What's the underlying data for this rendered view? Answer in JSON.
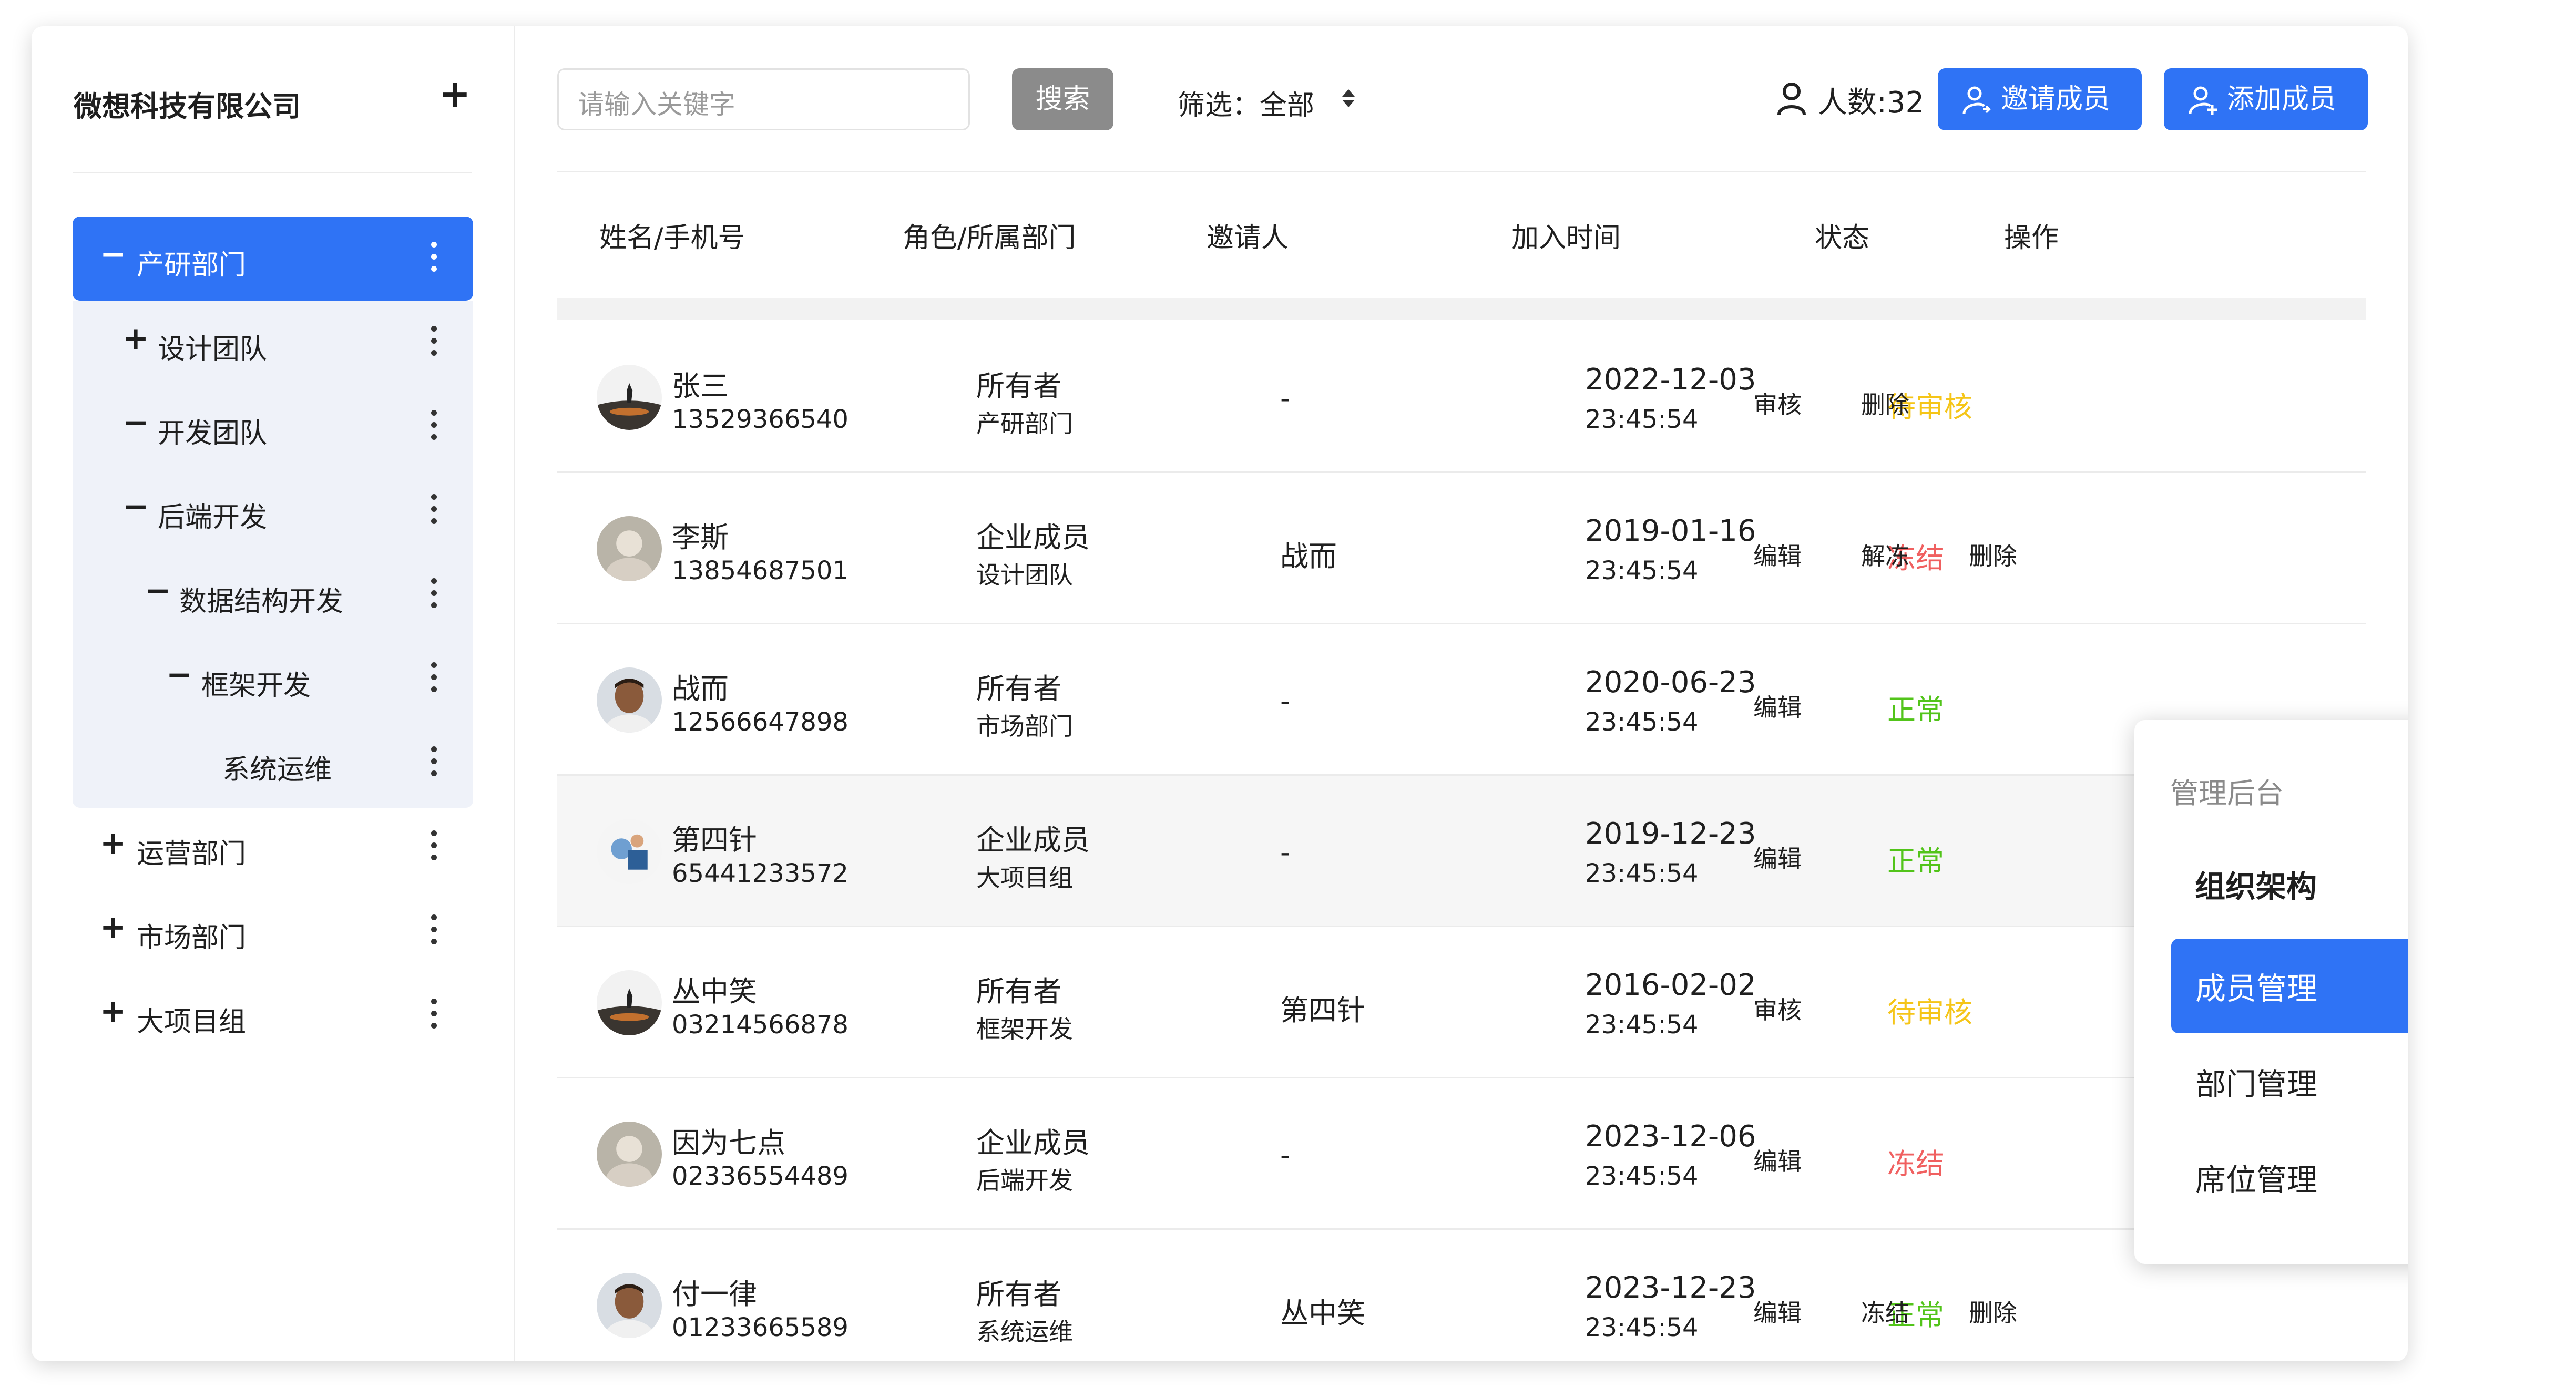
{
  "sidebar": {
    "company": "微想科技有限公司",
    "add_symbol": "+",
    "tree": [
      {
        "sign": "−",
        "label": "产研部门",
        "level": 0
      },
      {
        "sign": "+",
        "label": "设计团队",
        "level": 1
      },
      {
        "sign": "−",
        "label": "开发团队",
        "level": 1
      },
      {
        "sign": "−",
        "label": "后端开发",
        "level": 2
      },
      {
        "sign": "−",
        "label": "数据结构开发",
        "level": 3
      },
      {
        "sign": "−",
        "label": "框架开发",
        "level": 4
      },
      {
        "sign": "",
        "label": "系统运维",
        "level": 5
      },
      {
        "sign": "+",
        "label": "运营部门",
        "level": 0
      },
      {
        "sign": "+",
        "label": "市场部门",
        "level": 0
      },
      {
        "sign": "+",
        "label": "大项目组",
        "level": 0
      }
    ]
  },
  "toolbar": {
    "search_placeholder": "请输入关键字",
    "search_button": "搜索",
    "filter_label": "筛选：全部",
    "people_count": "人数:32",
    "invite_button": "邀请成员",
    "add_button": "添加成员"
  },
  "table": {
    "headers": [
      "姓名/手机号",
      "角色/所属部门",
      "邀请人",
      "加入时间",
      "状态",
      "操作"
    ],
    "rows": [
      {
        "name": "张三",
        "phone": "13529366540",
        "role": "所有者",
        "dept": "产研部门",
        "inviter": "-",
        "date": "2022-12-03",
        "time": "23:45:54",
        "status": "待审核",
        "ops": [
          "审核",
          "删除"
        ],
        "avatar": "silhouette"
      },
      {
        "name": "李斯",
        "phone": "13854687501",
        "role": "企业成员",
        "dept": "设计团队",
        "inviter": "战而",
        "date": "2019-01-16",
        "time": "23:45:54",
        "status": "冻结",
        "ops": [
          "编辑",
          "解冻",
          "删除"
        ],
        "avatar": "pale"
      },
      {
        "name": "战而",
        "phone": "12566647898",
        "role": "所有者",
        "dept": "市场部门",
        "inviter": "-",
        "date": "2020-06-23",
        "time": "23:45:54",
        "status": "正常",
        "ops": [
          "编辑"
        ],
        "avatar": "face"
      },
      {
        "name": "第四针",
        "phone": "65441233572",
        "role": "企业成员",
        "dept": "大项目组",
        "inviter": "-",
        "date": "2019-12-23",
        "time": "23:45:54",
        "status": "正常",
        "ops": [
          "编辑"
        ],
        "avatar": "blue"
      },
      {
        "name": "丛中笑",
        "phone": "03214566878",
        "role": "所有者",
        "dept": "框架开发",
        "inviter": "第四针",
        "date": "2016-02-02",
        "time": "23:45:54",
        "status": "待审核",
        "ops": [
          "审核"
        ],
        "avatar": "silhouette"
      },
      {
        "name": "因为七点",
        "phone": "02336554489",
        "role": "企业成员",
        "dept": "后端开发",
        "inviter": "-",
        "date": "2023-12-06",
        "time": "23:45:54",
        "status": "冻结",
        "ops": [
          "编辑"
        ],
        "avatar": "pale"
      },
      {
        "name": "付一律",
        "phone": "01233665589",
        "role": "所有者",
        "dept": "系统运维",
        "inviter": "丛中笑",
        "date": "2023-12-23",
        "time": "23:45:54",
        "status": "正常",
        "ops": [
          "编辑",
          "冻结",
          "删除"
        ],
        "avatar": "face"
      }
    ]
  },
  "status_colors": {
    "待审核": "#f5c518",
    "冻结": "#f06060",
    "正常": "#52c41a"
  },
  "accent": "#2f73f5",
  "menu": {
    "header": "管理后台",
    "group": "组织架构",
    "items": [
      "成员管理",
      "部门管理",
      "席位管理"
    ]
  }
}
